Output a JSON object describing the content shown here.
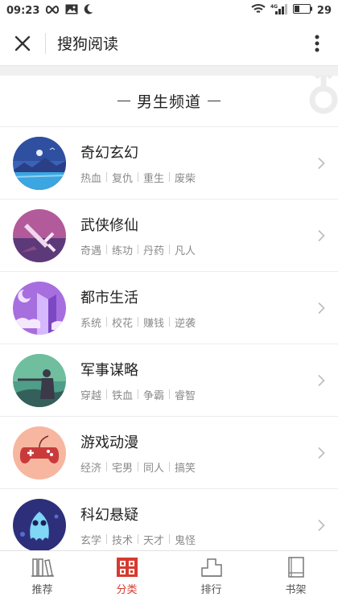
{
  "status_bar": {
    "time": "09:23",
    "battery": "29",
    "network": "4G"
  },
  "header": {
    "title": "搜狗阅读"
  },
  "channel": {
    "title": "男生频道"
  },
  "categories": [
    {
      "name": "奇幻玄幻",
      "tags": [
        "热血",
        "复仇",
        "重生",
        "废柴"
      ]
    },
    {
      "name": "武侠修仙",
      "tags": [
        "奇遇",
        "练功",
        "丹药",
        "凡人"
      ]
    },
    {
      "name": "都市生活",
      "tags": [
        "系统",
        "校花",
        "赚钱",
        "逆袭"
      ]
    },
    {
      "name": "军事谋略",
      "tags": [
        "穿越",
        "铁血",
        "争霸",
        "睿智"
      ]
    },
    {
      "name": "游戏动漫",
      "tags": [
        "经济",
        "宅男",
        "同人",
        "搞笑"
      ]
    },
    {
      "name": "科幻悬疑",
      "tags": [
        "玄学",
        "技术",
        "天才",
        "鬼怪"
      ]
    }
  ],
  "tabs": [
    {
      "label": "推荐",
      "icon": "books-icon",
      "active": false
    },
    {
      "label": "分类",
      "icon": "category-grid-icon",
      "active": true
    },
    {
      "label": "排行",
      "icon": "ranking-icon",
      "active": false
    },
    {
      "label": "书架",
      "icon": "bookshelf-icon",
      "active": false
    }
  ],
  "colors": {
    "accent": "#d63a2e"
  }
}
